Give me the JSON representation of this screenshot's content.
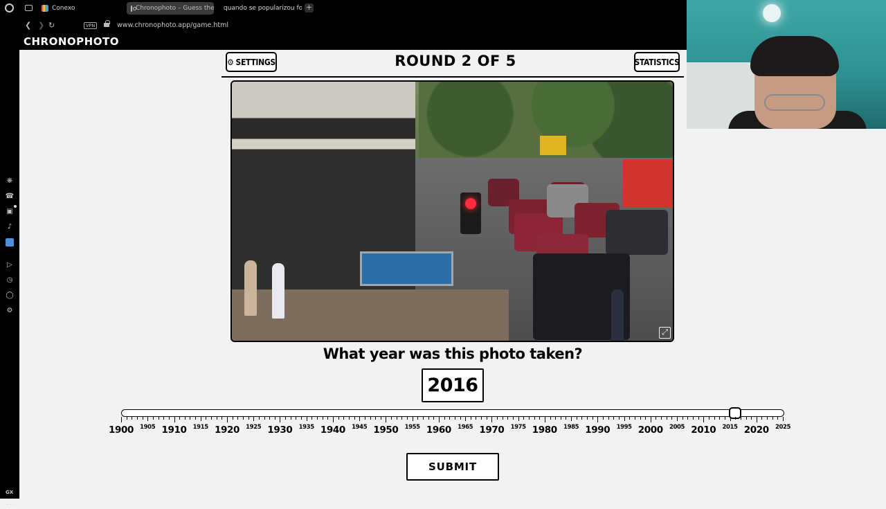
{
  "browser": {
    "tabs": [
      {
        "label": "Conexo",
        "icon": "conexo-favicon"
      },
      {
        "label": "Chronophoto – Guess the",
        "icon": "camera-icon",
        "active": true
      },
      {
        "label": "quando se popularizou fot",
        "icon": "google-favicon"
      }
    ],
    "new_tab_label": "+",
    "vpn_label": "VPN",
    "url": "www.chronophoto.app/game.html"
  },
  "sidebar": {
    "icons": [
      "chatgpt-icon",
      "whatsapp-icon",
      "instagram-icon",
      "tiktok-icon",
      "app-icon",
      "send-icon",
      "history-icon",
      "extensions-icon",
      "settings-icon"
    ],
    "gx_label": "GX",
    "more_label": "···"
  },
  "site": {
    "title": "CHRONOPHOTO"
  },
  "game": {
    "settings_label": "SETTINGS",
    "statistics_label": "STATISTICS",
    "round_title": "ROUND 2 OF 5",
    "question": "What year was this photo taken?",
    "selected_year": "2016",
    "slider": {
      "min": 1900,
      "max": 2025,
      "value": 2016
    },
    "major_labels": [
      "1900",
      "1910",
      "1920",
      "1930",
      "1940",
      "1950",
      "1960",
      "1970",
      "1980",
      "1990",
      "2000",
      "2010",
      "2020"
    ],
    "minor_labels": [
      "1905",
      "1915",
      "1925",
      "1935",
      "1945",
      "1955",
      "1965",
      "1975",
      "1985",
      "1995",
      "2005",
      "2015",
      "2025"
    ],
    "submit_label": "SUBMIT"
  }
}
